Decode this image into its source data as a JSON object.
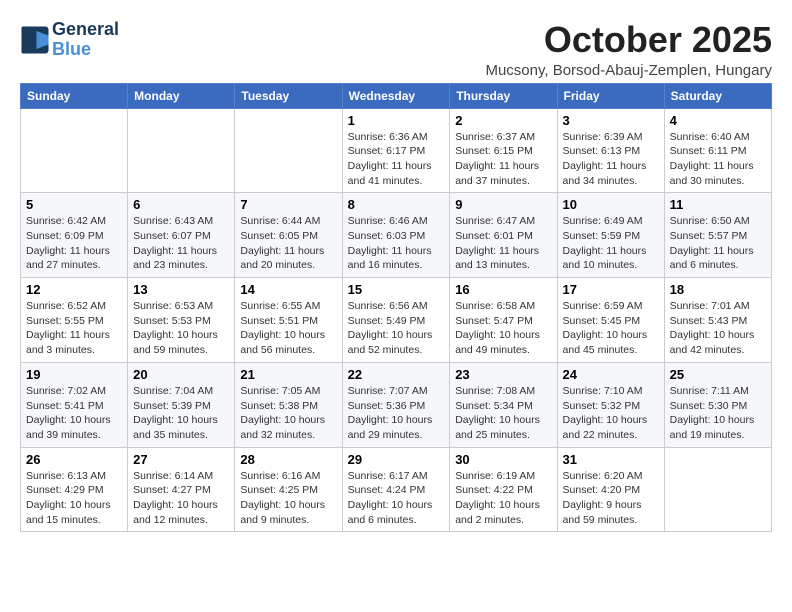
{
  "header": {
    "logo_line1": "General",
    "logo_line2": "Blue",
    "month": "October 2025",
    "location": "Mucsony, Borsod-Abauj-Zemplen, Hungary"
  },
  "weekdays": [
    "Sunday",
    "Monday",
    "Tuesday",
    "Wednesday",
    "Thursday",
    "Friday",
    "Saturday"
  ],
  "weeks": [
    [
      {
        "day": "",
        "info": ""
      },
      {
        "day": "",
        "info": ""
      },
      {
        "day": "",
        "info": ""
      },
      {
        "day": "1",
        "info": "Sunrise: 6:36 AM\nSunset: 6:17 PM\nDaylight: 11 hours\nand 41 minutes."
      },
      {
        "day": "2",
        "info": "Sunrise: 6:37 AM\nSunset: 6:15 PM\nDaylight: 11 hours\nand 37 minutes."
      },
      {
        "day": "3",
        "info": "Sunrise: 6:39 AM\nSunset: 6:13 PM\nDaylight: 11 hours\nand 34 minutes."
      },
      {
        "day": "4",
        "info": "Sunrise: 6:40 AM\nSunset: 6:11 PM\nDaylight: 11 hours\nand 30 minutes."
      }
    ],
    [
      {
        "day": "5",
        "info": "Sunrise: 6:42 AM\nSunset: 6:09 PM\nDaylight: 11 hours\nand 27 minutes."
      },
      {
        "day": "6",
        "info": "Sunrise: 6:43 AM\nSunset: 6:07 PM\nDaylight: 11 hours\nand 23 minutes."
      },
      {
        "day": "7",
        "info": "Sunrise: 6:44 AM\nSunset: 6:05 PM\nDaylight: 11 hours\nand 20 minutes."
      },
      {
        "day": "8",
        "info": "Sunrise: 6:46 AM\nSunset: 6:03 PM\nDaylight: 11 hours\nand 16 minutes."
      },
      {
        "day": "9",
        "info": "Sunrise: 6:47 AM\nSunset: 6:01 PM\nDaylight: 11 hours\nand 13 minutes."
      },
      {
        "day": "10",
        "info": "Sunrise: 6:49 AM\nSunset: 5:59 PM\nDaylight: 11 hours\nand 10 minutes."
      },
      {
        "day": "11",
        "info": "Sunrise: 6:50 AM\nSunset: 5:57 PM\nDaylight: 11 hours\nand 6 minutes."
      }
    ],
    [
      {
        "day": "12",
        "info": "Sunrise: 6:52 AM\nSunset: 5:55 PM\nDaylight: 11 hours\nand 3 minutes."
      },
      {
        "day": "13",
        "info": "Sunrise: 6:53 AM\nSunset: 5:53 PM\nDaylight: 10 hours\nand 59 minutes."
      },
      {
        "day": "14",
        "info": "Sunrise: 6:55 AM\nSunset: 5:51 PM\nDaylight: 10 hours\nand 56 minutes."
      },
      {
        "day": "15",
        "info": "Sunrise: 6:56 AM\nSunset: 5:49 PM\nDaylight: 10 hours\nand 52 minutes."
      },
      {
        "day": "16",
        "info": "Sunrise: 6:58 AM\nSunset: 5:47 PM\nDaylight: 10 hours\nand 49 minutes."
      },
      {
        "day": "17",
        "info": "Sunrise: 6:59 AM\nSunset: 5:45 PM\nDaylight: 10 hours\nand 45 minutes."
      },
      {
        "day": "18",
        "info": "Sunrise: 7:01 AM\nSunset: 5:43 PM\nDaylight: 10 hours\nand 42 minutes."
      }
    ],
    [
      {
        "day": "19",
        "info": "Sunrise: 7:02 AM\nSunset: 5:41 PM\nDaylight: 10 hours\nand 39 minutes."
      },
      {
        "day": "20",
        "info": "Sunrise: 7:04 AM\nSunset: 5:39 PM\nDaylight: 10 hours\nand 35 minutes."
      },
      {
        "day": "21",
        "info": "Sunrise: 7:05 AM\nSunset: 5:38 PM\nDaylight: 10 hours\nand 32 minutes."
      },
      {
        "day": "22",
        "info": "Sunrise: 7:07 AM\nSunset: 5:36 PM\nDaylight: 10 hours\nand 29 minutes."
      },
      {
        "day": "23",
        "info": "Sunrise: 7:08 AM\nSunset: 5:34 PM\nDaylight: 10 hours\nand 25 minutes."
      },
      {
        "day": "24",
        "info": "Sunrise: 7:10 AM\nSunset: 5:32 PM\nDaylight: 10 hours\nand 22 minutes."
      },
      {
        "day": "25",
        "info": "Sunrise: 7:11 AM\nSunset: 5:30 PM\nDaylight: 10 hours\nand 19 minutes."
      }
    ],
    [
      {
        "day": "26",
        "info": "Sunrise: 6:13 AM\nSunset: 4:29 PM\nDaylight: 10 hours\nand 15 minutes."
      },
      {
        "day": "27",
        "info": "Sunrise: 6:14 AM\nSunset: 4:27 PM\nDaylight: 10 hours\nand 12 minutes."
      },
      {
        "day": "28",
        "info": "Sunrise: 6:16 AM\nSunset: 4:25 PM\nDaylight: 10 hours\nand 9 minutes."
      },
      {
        "day": "29",
        "info": "Sunrise: 6:17 AM\nSunset: 4:24 PM\nDaylight: 10 hours\nand 6 minutes."
      },
      {
        "day": "30",
        "info": "Sunrise: 6:19 AM\nSunset: 4:22 PM\nDaylight: 10 hours\nand 2 minutes."
      },
      {
        "day": "31",
        "info": "Sunrise: 6:20 AM\nSunset: 4:20 PM\nDaylight: 9 hours\nand 59 minutes."
      },
      {
        "day": "",
        "info": ""
      }
    ]
  ]
}
